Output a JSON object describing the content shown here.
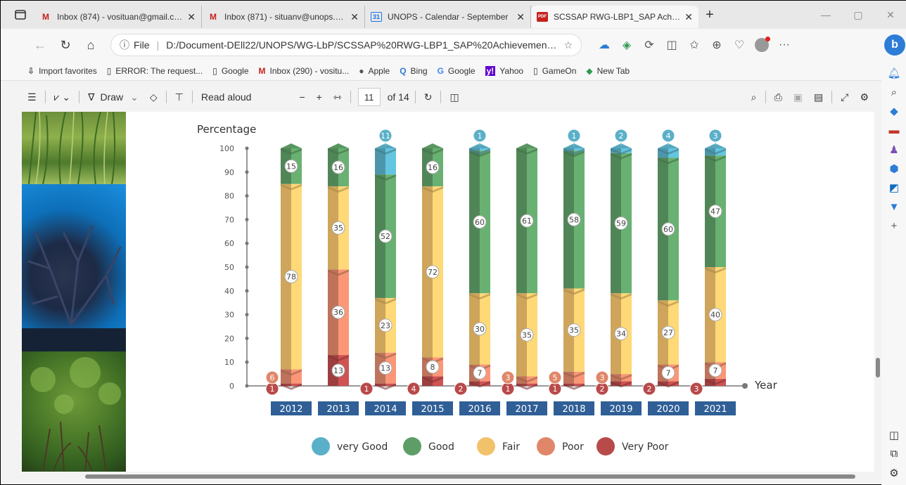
{
  "browser": {
    "tabs": [
      {
        "favicon": "M",
        "favicon_color": "#c5221f",
        "title": "Inbox (874) - vosituan@gmail.com"
      },
      {
        "favicon": "M",
        "favicon_color": "#c5221f",
        "title": "Inbox (871) - situanv@unops.org"
      },
      {
        "favicon": "31",
        "favicon_color": "#1a73e8",
        "title": "UNOPS - Calendar - September"
      },
      {
        "favicon": "PDF",
        "favicon_color": "#c5221f",
        "title": "SCSSAP RWG-LBP1_SAP Achieve"
      }
    ],
    "new_tab": "+",
    "address": {
      "scheme_label": "File",
      "url": "D:/Document-DEll22/UNOPS/WG-LbP/SCSSAP%20RWG-LBP1_SAP%20Achievements_T..."
    },
    "favorites": [
      {
        "icon": "import-icon",
        "label": "Import favorites"
      },
      {
        "icon": "page-icon",
        "label": "ERROR: The request..."
      },
      {
        "icon": "page-icon",
        "label": "Google"
      },
      {
        "icon": "gmail-icon",
        "label": "Inbox (290) - vositu..."
      },
      {
        "icon": "apple-icon",
        "label": "Apple"
      },
      {
        "icon": "search-icon",
        "label": "Bing"
      },
      {
        "icon": "google-icon",
        "label": "Google"
      },
      {
        "icon": "yahoo-icon",
        "label": "Yahoo"
      },
      {
        "icon": "page-icon",
        "label": "GameOn"
      },
      {
        "icon": "newtab-icon",
        "label": "New Tab"
      }
    ]
  },
  "pdf_toolbar": {
    "draw_label": "Draw",
    "read_aloud_label": "Read aloud",
    "zoom_minus": "−",
    "zoom_plus": "+",
    "page_current": "11",
    "page_total": "of 14"
  },
  "colors": {
    "very_good": "#5ab0c8",
    "good": "#5e9e66",
    "fair": "#f2c26a",
    "poor": "#e0876a",
    "very_poor": "#b94a4a",
    "year_badge": "#2f5f96"
  },
  "chart_data": {
    "type": "bar",
    "stacked": true,
    "ylabel": "Percentage",
    "xlabel": "Year",
    "ylim": [
      0,
      100
    ],
    "yticks": [
      0,
      10,
      20,
      30,
      40,
      50,
      60,
      70,
      80,
      90,
      100
    ],
    "categories": [
      "2012",
      "2013",
      "2014",
      "2015",
      "2016",
      "2017",
      "2018",
      "2019",
      "2020",
      "2021"
    ],
    "series": [
      {
        "name": "Very Poor",
        "color_key": "very_poor",
        "values": [
          1,
          13,
          1,
          4,
          2,
          1,
          1,
          2,
          2,
          3
        ]
      },
      {
        "name": "Poor",
        "color_key": "poor",
        "values": [
          6,
          36,
          13,
          8,
          7,
          3,
          5,
          3,
          7,
          7
        ]
      },
      {
        "name": "Fair",
        "color_key": "fair",
        "values": [
          78,
          35,
          23,
          72,
          30,
          35,
          35,
          34,
          27,
          40
        ]
      },
      {
        "name": "Good",
        "color_key": "good",
        "values": [
          15,
          16,
          52,
          16,
          60,
          61,
          58,
          59,
          60,
          47
        ]
      },
      {
        "name": "very Good",
        "color_key": "very_good",
        "values": [
          0,
          0,
          11,
          0,
          1,
          0,
          1,
          2,
          4,
          3
        ]
      }
    ],
    "legend": [
      "very Good",
      "Good",
      "Fair",
      "Poor",
      "Very Poor"
    ],
    "legend_position": "bottom"
  }
}
